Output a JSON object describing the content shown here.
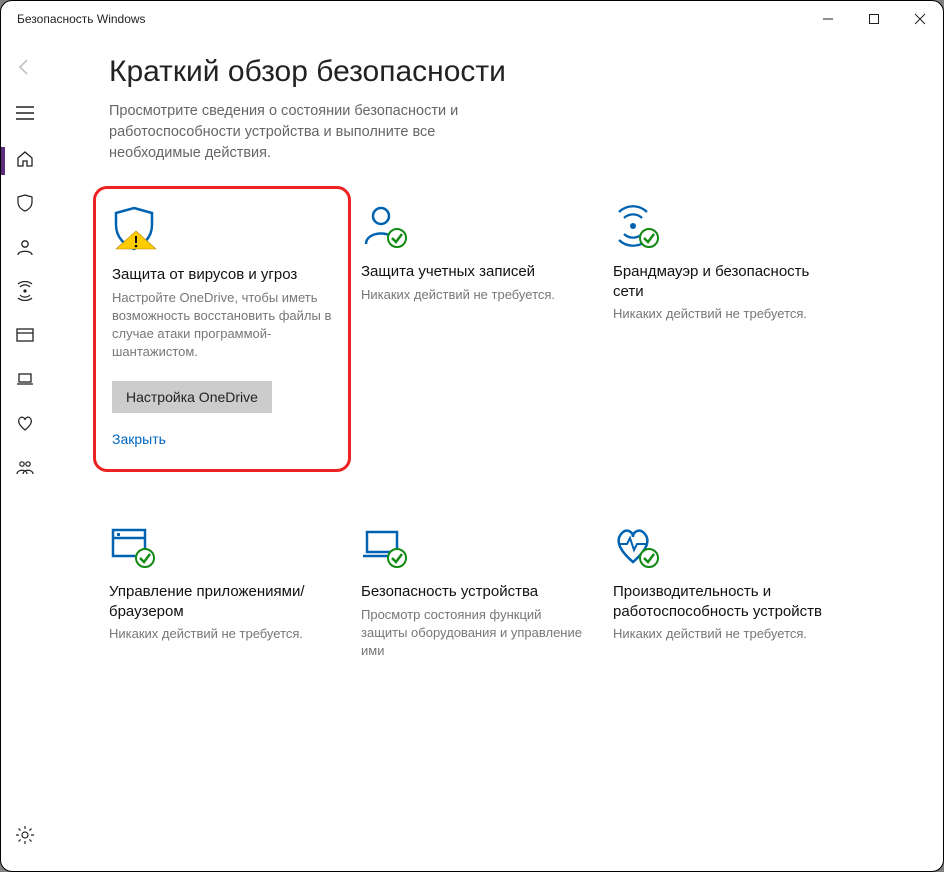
{
  "window": {
    "title": "Безопасность Windows"
  },
  "header": {
    "title": "Краткий обзор безопасности",
    "subtitle": "Просмотрите сведения о состоянии безопасности и работоспособности устройства и выполните все необходимые действия."
  },
  "cards": {
    "virus": {
      "title": "Защита от вирусов и угроз",
      "desc": "Настройте OneDrive, чтобы иметь возможность восстановить файлы в случае атаки программой-шантажистом.",
      "button": "Настройка OneDrive",
      "dismiss": "Закрыть"
    },
    "account": {
      "title": "Защита учетных записей",
      "desc": "Никаких действий не требуется."
    },
    "firewall": {
      "title": "Брандмауэр и безопасность сети",
      "desc": "Никаких действий не требуется."
    },
    "appbrowser": {
      "title": "Управление приложениями/браузером",
      "desc": "Никаких действий не требуется."
    },
    "device": {
      "title": "Безопасность устройства",
      "desc": "Просмотр состояния функций защиты оборудования и управление ими"
    },
    "health": {
      "title": "Производительность и работоспособность устройств",
      "desc": "Никаких действий не требуется."
    }
  }
}
